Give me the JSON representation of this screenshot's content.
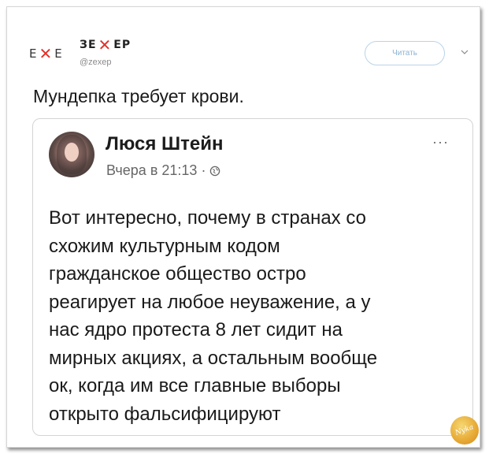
{
  "tweet": {
    "logo_left": "E",
    "logo_right": "E",
    "account_prefix": "ЗЕ",
    "account_suffix": "ЕР",
    "account_x": "✕",
    "handle": "@zexep",
    "follow_label": "Читать",
    "text": "Мундепка требует крови."
  },
  "card": {
    "author": "Люся Штейн",
    "time": "Вчера в 21:13",
    "separator": "·",
    "more": "···",
    "lines": [
      "Вот интересно, почему в странах со",
      "схожим культурным кодом",
      "гражданское общество остро",
      "реагирует на любое неуважение, а у",
      "нас ядро протеста 8 лет сидит на",
      "мирных акциях, а остальным вообще",
      "ок, когда им все главные выборы",
      "открыто фальсифицируют"
    ]
  },
  "watermark": {
    "text": "Nyka"
  },
  "colors": {
    "logo_x": "#e0322b",
    "follow_border": "#b9d3e8",
    "follow_text": "#8db3d3"
  }
}
